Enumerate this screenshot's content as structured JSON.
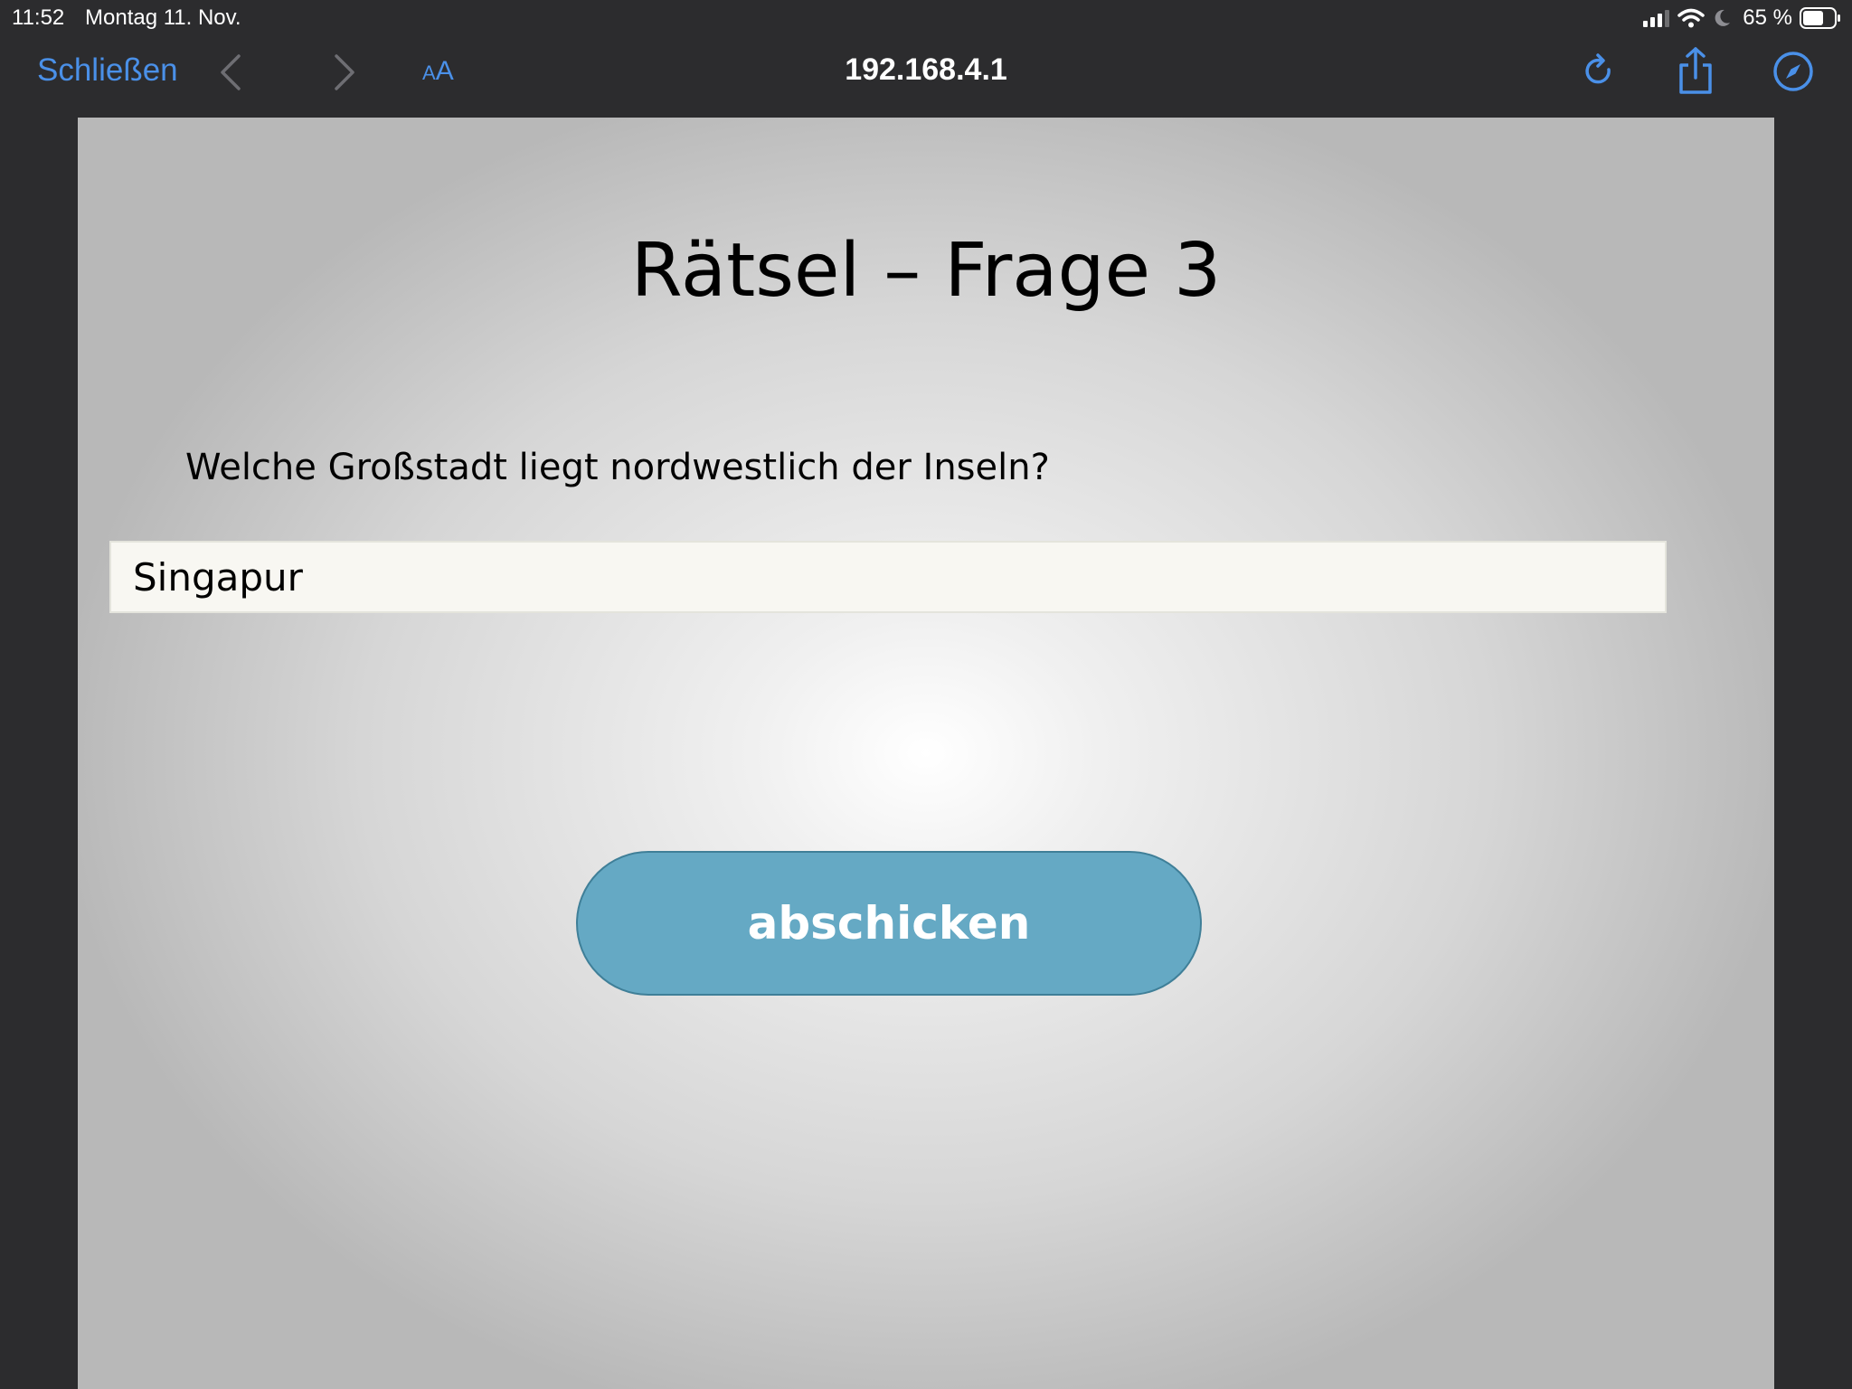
{
  "status_bar": {
    "time": "11:52",
    "date": "Montag 11. Nov.",
    "battery": "65 %",
    "icons": [
      "cellular-signal-icon",
      "wifi-icon",
      "moon-icon",
      "battery-icon"
    ]
  },
  "toolbar": {
    "close_label": "Schließen",
    "text_size_small": "A",
    "text_size_large": "A",
    "url": "192.168.4.1",
    "icons": [
      "back-chevron-icon",
      "forward-chevron-icon",
      "reload-icon",
      "share-icon",
      "compass-icon"
    ],
    "accent_color": "#4a90e8"
  },
  "page": {
    "title": "Rätsel – Frage 3",
    "question": "Welche Großstadt liegt nordwestlich der Inseln?",
    "answer_value": "Singapur",
    "submit_label": "abschicken",
    "button_color": "#65a9c4"
  }
}
